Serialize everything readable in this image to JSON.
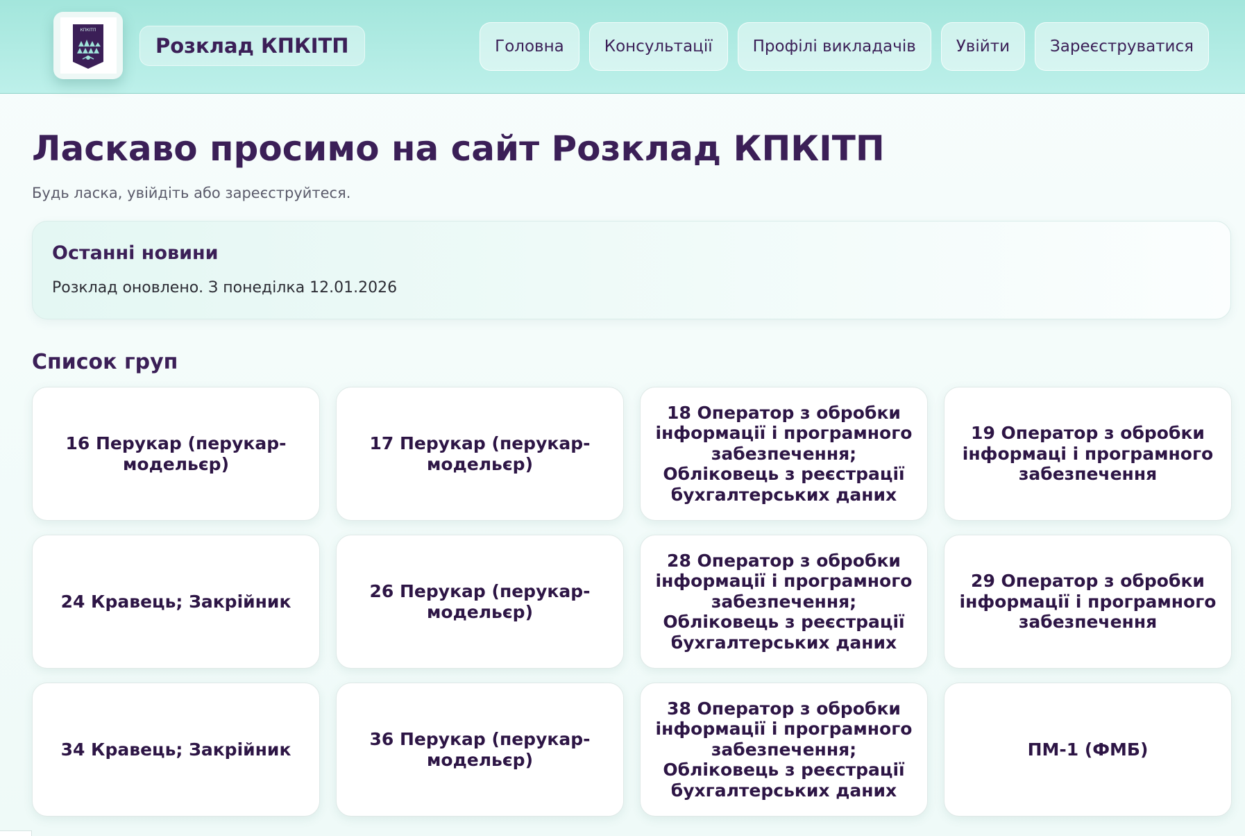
{
  "header": {
    "logo_icon": "college-emblem-icon",
    "logo_text": "КПКІТП",
    "brand": "Розклад КПКІТП",
    "nav": [
      {
        "label": "Головна"
      },
      {
        "label": "Консультації"
      },
      {
        "label": "Профілі викладачів"
      },
      {
        "label": "Увійти"
      },
      {
        "label": "Зареєструватися"
      }
    ]
  },
  "main": {
    "title": "Ласкаво просимо на сайт Розклад КПКІТП",
    "subtitle": "Будь ласка, увійдіть або зареєструйтеся.",
    "news": {
      "title": "Останні новини",
      "text": "Розклад оновлено. З понеділка 12.01.2026"
    },
    "groups_title": "Список груп",
    "groups": [
      {
        "name": "16 Перукар (перукар-модельєр)"
      },
      {
        "name": "17 Перукар (перукар-модельєр)"
      },
      {
        "name": "18 Оператор з обробки інформації і програмного забезпечення; Обліковець з реєстрації бухгалтерських даних"
      },
      {
        "name": "19 Оператор з обробки інформаці і програмного забезпечення"
      },
      {
        "name": "24 Кравець; Закрійник"
      },
      {
        "name": "26 Перукар (перукар-модельєр)"
      },
      {
        "name": "28 Оператор з обробки інформації і програмного забезпечення; Обліковець з реєстрації бухгалтерських даних"
      },
      {
        "name": "29 Оператор з обробки інформації і програмного забезпечення"
      },
      {
        "name": "34 Кравець; Закрійник"
      },
      {
        "name": "36 Перукар (перукар-модельєр)"
      },
      {
        "name": "38 Оператор з обробки інформації і програмного забезпечення; Обліковець з реєстрації бухгалтерських даних"
      },
      {
        "name": "ПМ-1 (ФМБ)"
      }
    ]
  },
  "colors": {
    "header_bg": "#a3e6dc",
    "brand_purple": "#3b1f57",
    "card_bg": "#ffffff"
  }
}
